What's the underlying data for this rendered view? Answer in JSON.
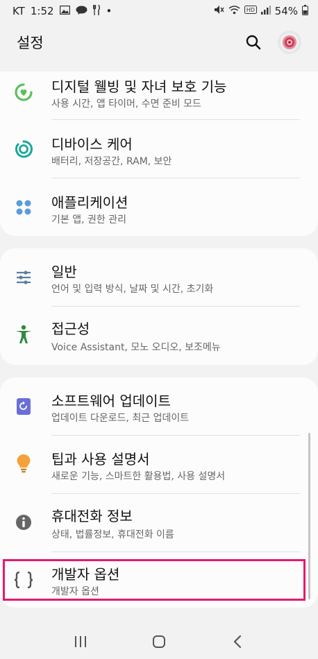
{
  "status_bar": {
    "carrier": "KT",
    "time": "1:52",
    "dot": "•",
    "battery": "54%"
  },
  "header": {
    "title": "설정"
  },
  "sections": [
    {
      "items": [
        {
          "title": "디지털 웰빙 및 자녀 보호 기능",
          "subtitle": "사용 시간, 앱 타이머, 수면 준비 모드",
          "icon": "digital-wellbeing-icon",
          "icon_color": "#5cbf5f"
        },
        {
          "title": "디바이스 케어",
          "subtitle": "배터리, 저장공간, RAM, 보안",
          "icon": "device-care-icon",
          "icon_color": "#1aa79a"
        },
        {
          "title": "애플리케이션",
          "subtitle": "기본 앱, 권한 관리",
          "icon": "apps-icon",
          "icon_color": "#5c9bdc"
        }
      ]
    },
    {
      "items": [
        {
          "title": "일반",
          "subtitle": "언어 및 입력 방식, 날짜 및 시간, 초기화",
          "icon": "sliders-icon",
          "icon_color": "#5a7fa0"
        },
        {
          "title": "접근성",
          "subtitle": "Voice Assistant, 모노 오디오, 보조메뉴",
          "icon": "accessibility-icon",
          "icon_color": "#2e8b3e"
        }
      ]
    },
    {
      "items": [
        {
          "title": "소프트웨어 업데이트",
          "subtitle": "업데이트 다운로드, 최근 업데이트",
          "icon": "software-update-icon",
          "icon_color": "#6a6fd6"
        },
        {
          "title": "팁과 사용 설명서",
          "subtitle": "새로운 기능, 스마트한 활용법, 사용 설명서",
          "icon": "lightbulb-icon",
          "icon_color": "#f3a33a"
        },
        {
          "title": "휴대전화 정보",
          "subtitle": "상태, 법률정보, 휴대전화 이름",
          "icon": "info-icon",
          "icon_color": "#666666"
        },
        {
          "title": "개발자 옵션",
          "subtitle": "개발자 옵션",
          "icon": "developer-braces-icon",
          "icon_color": "#555555"
        }
      ]
    }
  ],
  "colors": {
    "highlight": "#e8186f",
    "background": "#f2f2f2",
    "card": "#fcfcfc"
  }
}
